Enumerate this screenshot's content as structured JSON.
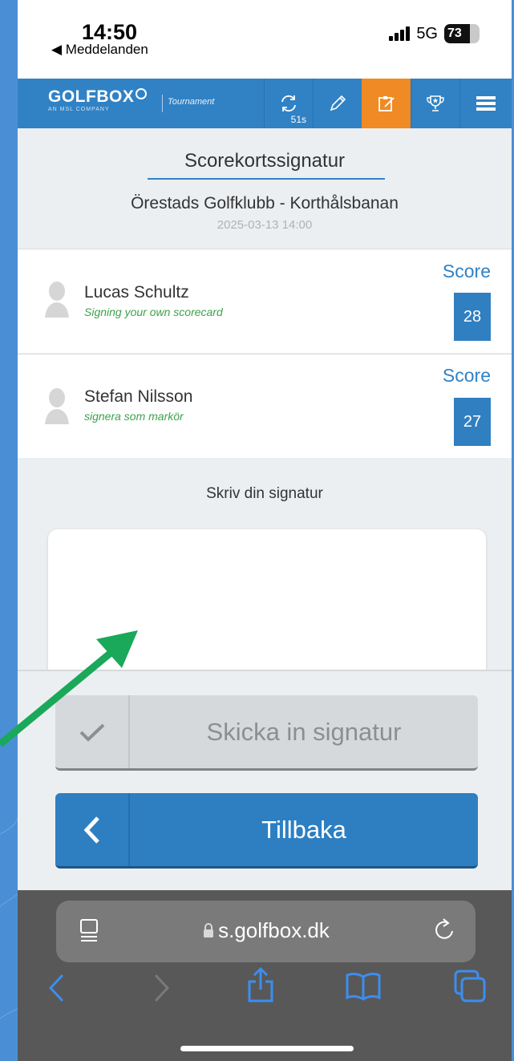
{
  "status_bar": {
    "time": "14:50",
    "back_label": "◀ Meddelanden",
    "network": "5G",
    "battery": "73",
    "battery_level": 0.73
  },
  "header": {
    "brand": "GOLFBOX",
    "brand_sub": "AN MSL COMPANY",
    "product": "Tournament",
    "refresh_count": "51s",
    "icons": [
      "refresh-icon",
      "pencil-icon",
      "scorecard-sign-icon",
      "trophy-icon",
      "menu-icon"
    ],
    "accent_color": "#3082c5",
    "active_color": "#f08a24"
  },
  "page": {
    "title": "Scorekortssignatur",
    "club": "Örestads Golfklubb - Korthålsbanan",
    "date": "2025-03-13 14:00"
  },
  "players": [
    {
      "name": "Lucas Schultz",
      "subtitle": "Signing your own scorecard",
      "score_label": "Score",
      "score": "28"
    },
    {
      "name": "Stefan Nilsson",
      "subtitle": "signera som markör",
      "score_label": "Score",
      "score": "27"
    }
  ],
  "signature": {
    "label": "Skriv din signatur"
  },
  "buttons": {
    "submit_label": "Skicka in signatur",
    "back_label": "Tillbaka"
  },
  "browser": {
    "url": "s.golfbox.dk"
  }
}
